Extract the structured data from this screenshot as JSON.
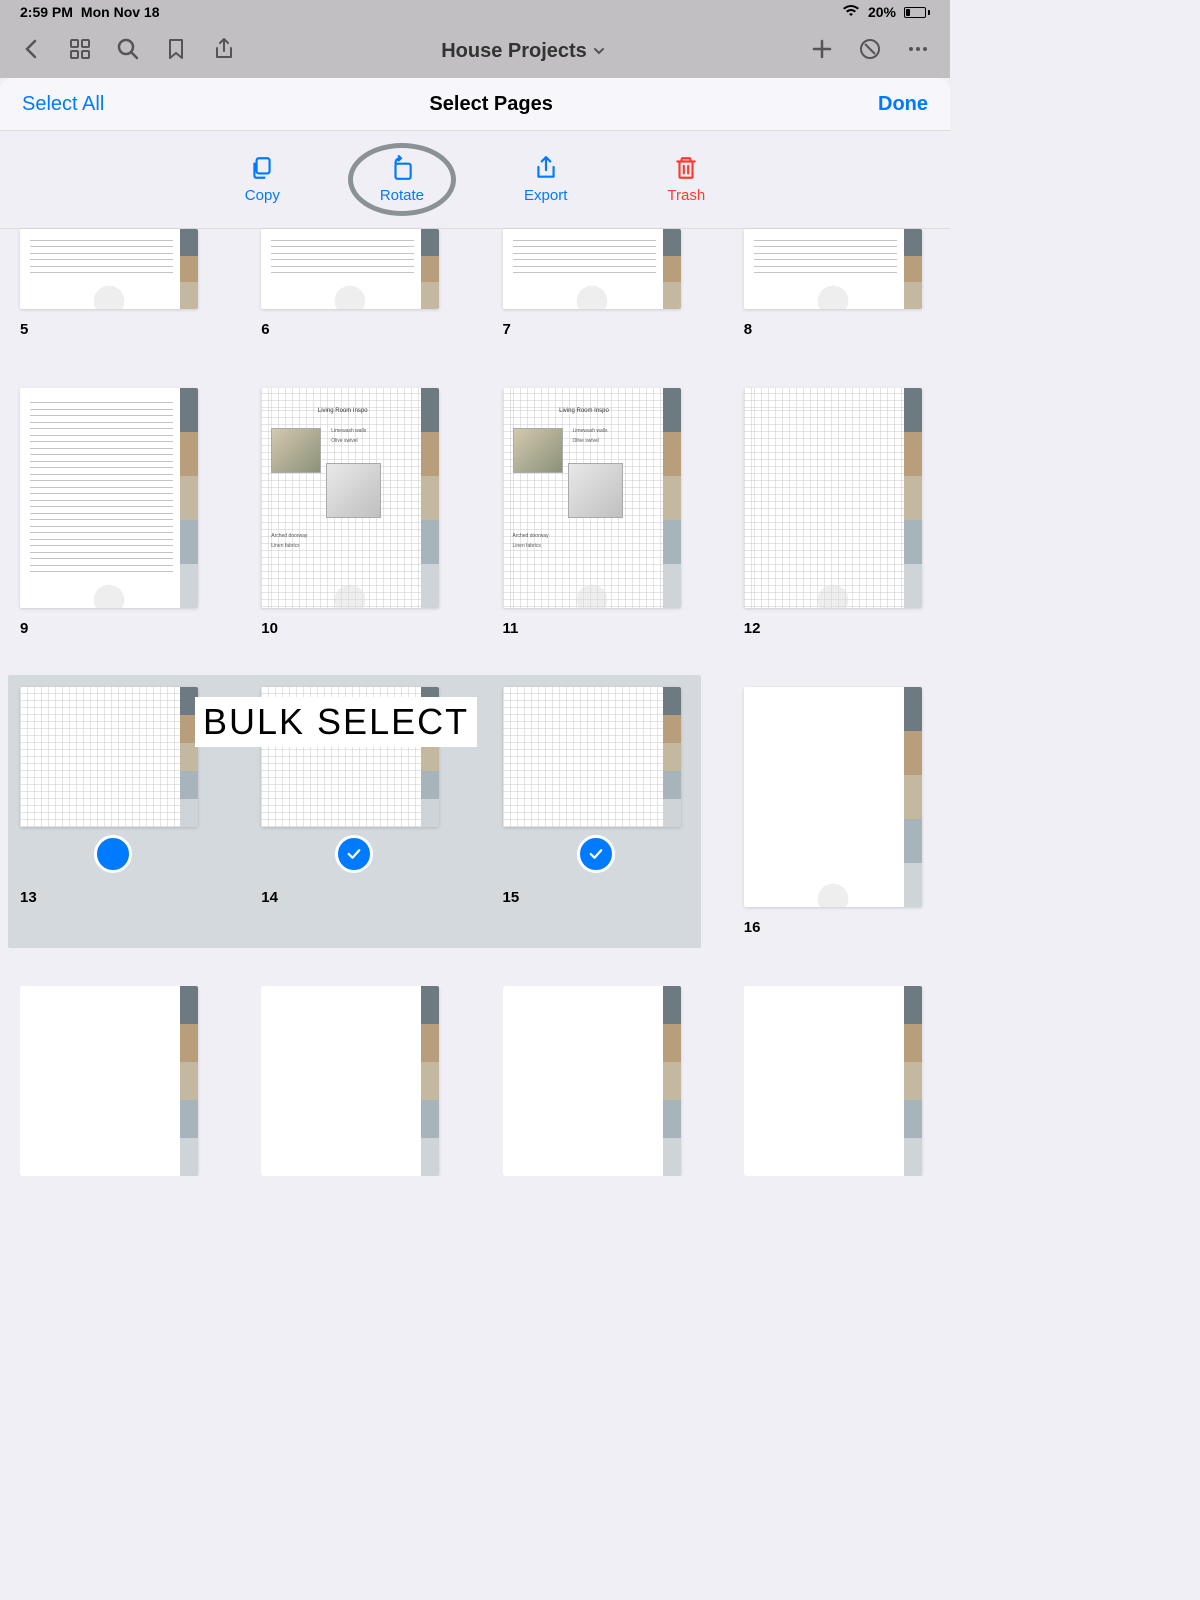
{
  "status": {
    "time": "2:59 PM",
    "date": "Mon Nov 18",
    "battery_pct": "20%"
  },
  "toolbar": {
    "title": "House Projects"
  },
  "select_header": {
    "select_all": "Select All",
    "title": "Select Pages",
    "done": "Done"
  },
  "actions": {
    "copy": "Copy",
    "rotate": "Rotate",
    "export": "Export",
    "trash": "Trash"
  },
  "pages": {
    "p5": "5",
    "p6": "6",
    "p7": "7",
    "p8": "8",
    "p9": "9",
    "p10": "10",
    "p11": "11",
    "p12": "12",
    "p13": "13",
    "p14": "14",
    "p15": "15",
    "p16": "16"
  },
  "annotation": {
    "bulk_select": "BULK SELECT"
  },
  "collage": {
    "title": "Living Room Inspo",
    "text1": "Limewash walls",
    "text2": "Olive swivel",
    "text3": "Arched doorway",
    "text4": "Linen fabrics"
  }
}
